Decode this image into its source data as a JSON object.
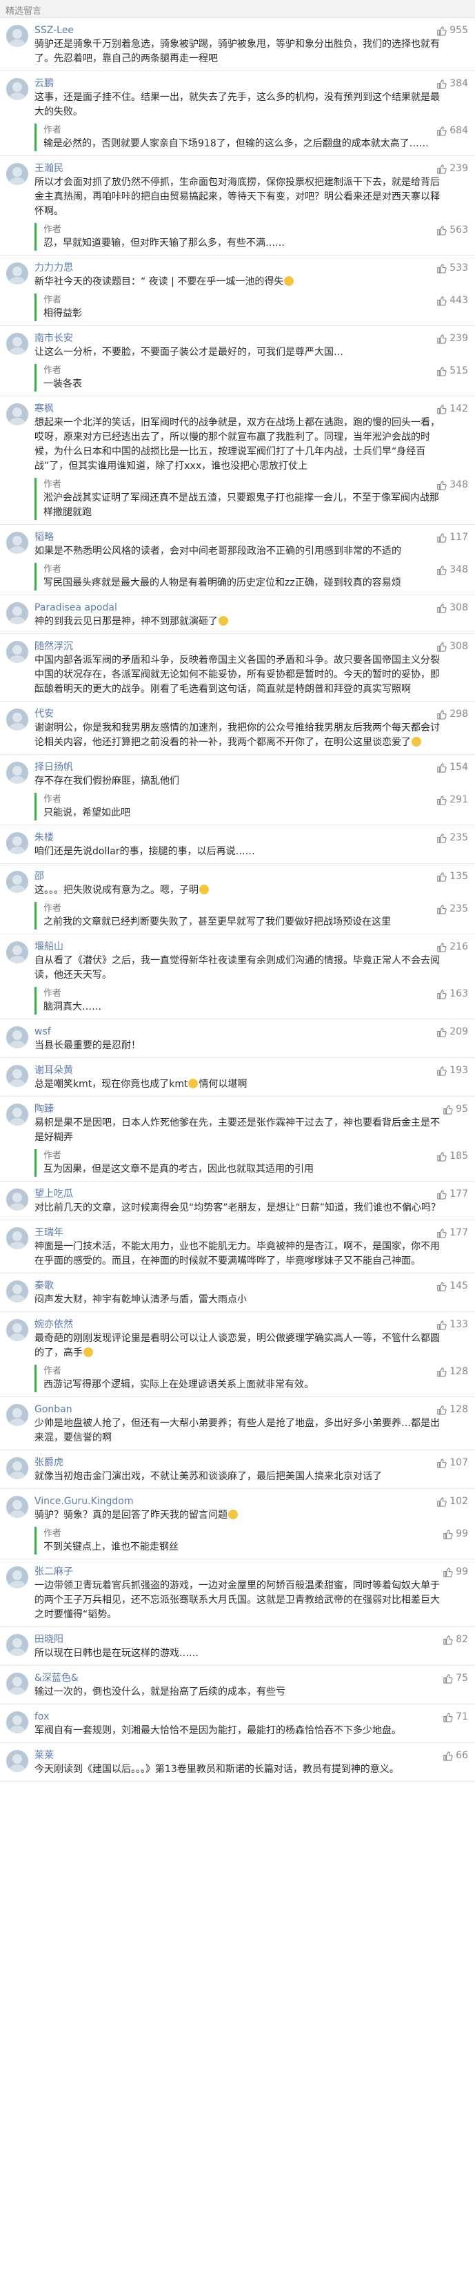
{
  "header": {
    "title": "精选留言"
  },
  "colors": {
    "name": "#5b7ba8",
    "author_bar": "#3cb043",
    "muted": "#8a8a8a"
  },
  "icons": {
    "like": "thumb-up-icon",
    "emoji": "emoji-icon"
  },
  "comments": [
    {
      "name": "SSZ-Lee",
      "likes": "955",
      "text": "骑驴还是骑象千万别着急选，骑象被驴踢，骑驴被象甩，等驴和象分出胜负，我们的选择也就有了。先忍着吧，靠自己的两条腿再走一程吧",
      "reply": null
    },
    {
      "name": "云鹏",
      "likes": "384",
      "text": "这事，还是面子挂不住。结果一出，就失去了先手，这么多的机构，没有预判到这个结果就是最大的失败。",
      "reply": {
        "name": "作者",
        "likes": "684",
        "text": "输是必然的，否则就要人家亲自下场918了，但输的这么多，之后翻盘的成本就太高了……"
      }
    },
    {
      "name": "王瀚民",
      "likes": "239",
      "text": "所以才会面对抓了放仍然不停抓，生命面包对海底捞，保你投票权把建制派干下去，就是给背后金主真热闹，再咱咔咔的把自由贸易搞起来，等待天下有变，对吧？明公看来还是对西天寨以释怀啊。",
      "reply": {
        "name": "作者",
        "likes": "563",
        "text": "忍，早就知道要输，但对昨天输了那么多，有些不满……"
      }
    },
    {
      "name": "力力力思",
      "likes": "533",
      "text": "新华社今天的夜读题目：“ 夜读 | 不要在乎一城一池的得失",
      "emoji": true,
      "reply": {
        "name": "作者",
        "likes": "443",
        "text": "相得益彰"
      }
    },
    {
      "name": "南市长安",
      "likes": "239",
      "text": "让这么一分析，不要脸，不要面子装公才是最好的，可我们是尊严大国…",
      "reply": {
        "name": "作者",
        "likes": "515",
        "text": "一装各表"
      }
    },
    {
      "name": "寒枫",
      "likes": "142",
      "text": "想起来一个北洋的笑话，旧军阀时代的战争就是，双方在战场上都在逃跑，跑的慢的回头一看，哎呀，原来对方已经逃出去了，所以慢的那个就宣布赢了我胜利了。同理，当年淞沪会战的时候，为什么日本和中国的战损比是一比五，按理说军阀们打了十几年内战，士兵们早“身经百战”了，但其实谁用谁知道，除了打xxx，谁也没把心思放打仗上",
      "reply": {
        "name": "作者",
        "likes": "348",
        "text": "淞沪会战其实证明了军阀还真不是战五渣，只要跟鬼子打也能撑一会儿，不至于像军阀内战那样撒腿就跑"
      }
    },
    {
      "name": "韬略",
      "likes": "117",
      "text": "如果是不熟悉明公风格的读者，会对中间老哥那段政治不正确的引用感到非常的不适的",
      "reply": {
        "name": "作者",
        "likes": "348",
        "text": "写民国最头疼就是最大最的人物是有着明确的历史定位和zz正确，碰到较真的容易烦"
      }
    },
    {
      "name": "Paradisea apodal",
      "likes": "308",
      "text": "神的到我云见日那是神，神不到那就演砸了",
      "emoji": true,
      "reply": null
    },
    {
      "name": "随然浮沉",
      "likes": "308",
      "text": "中国内部各派军阀的矛盾和斗争，反映着帝国主义各国的矛盾和斗争。故只要各国帝国主义分裂中国的状况存在，各派军阀就无论如何不能妥协，所有妥协都是暂时的。今天的暂时的妥协，即酝酿着明天的更大的战争。刚看了毛选看到这句话，简直就是特朗普和拜登的真实写照啊",
      "reply": null
    },
    {
      "name": "代安",
      "likes": "298",
      "text": "谢谢明公，你是我和我男朋友感情的加速剂，我把你的公众号推给我男朋友后我两个每天都会讨论相关内容，他还打算把之前没看的补一补，我两个都离不开你了，在明公这里谈恋爱了",
      "emoji": true,
      "reply": null
    },
    {
      "name": "择日扬帆",
      "likes": "154",
      "text": "存不存在我们假扮麻匪，搞乱他们",
      "reply": {
        "name": "作者",
        "likes": "291",
        "text": "只能说，希望如此吧"
      }
    },
    {
      "name": "朱楼",
      "likes": "235",
      "text": "咱们还是先说dollar的事，接腿的事，以后再说……",
      "reply": null
    },
    {
      "name": "邵",
      "likes": "135",
      "text": "这。。。把失败说成有意为之。嗯，子明",
      "emoji": true,
      "reply": {
        "name": "作者",
        "likes": "235",
        "text": "之前我的文章就已经判断要失败了，甚至更早就写了我们要做好把战场预设在这里"
      }
    },
    {
      "name": "堰船山",
      "likes": "216",
      "text": "自从看了《潜伏》之后，我一直觉得新华社夜读里有余则成们沟通的情报。毕竟正常人不会去阅读，他还天天写。",
      "reply": {
        "name": "作者",
        "likes": "163",
        "text": "脑洞真大……"
      }
    },
    {
      "name": "wsf",
      "likes": "209",
      "text": "当县长最重要的是忍耐！",
      "reply": null
    },
    {
      "name": "谢耳朵黄",
      "likes": "193",
      "text": "总是嘲笑kmt，现在你竟也成了kmt",
      "emoji": true,
      "tail": "情何以堪啊",
      "reply": null
    },
    {
      "name": "陶臻",
      "likes": "95",
      "text": "易帜是果不是因吧，日本人炸死他爹在先，主要还是张作霖神干过去了，神也要看背后金主是不是好糊弄",
      "reply": {
        "name": "作者",
        "likes": "185",
        "text": "互为因果，但是这文章不是真的考古，因此也就取其适用的引用"
      }
    },
    {
      "name": "望上吃瓜",
      "likes": "177",
      "text": "对比前几天的文章，这时候离得会见“均势客”老朋友，是想让“日薪”知道，我们谁也不偏心吗？",
      "reply": null
    },
    {
      "name": "王瑞年",
      "likes": "177",
      "text": "神面是一门技术活，不能太用力，业也不能肌无力。毕竟被神的是杏江，啊不，是国家，你不用在乎面的感受的。而且，在神面的时候就不要满嘴哗哗了，毕竟嗲嗲妹子又不能自己神面。",
      "reply": null
    },
    {
      "name": "秦歌",
      "likes": "145",
      "text": "闷声发大财，神宇有乾坤认清矛与盾，雷大雨点小",
      "reply": null
    },
    {
      "name": "婉亦依然",
      "likes": "133",
      "text": "最奇葩的刚刚发现评论里是看明公可以让人谈恋爱，明公做婆理学确实高人一等，不管什么都圆的了，高手",
      "emoji": true,
      "reply": {
        "name": "作者",
        "likes": "128",
        "text": "西游记写得那个逻辑，实际上在处理谚语关系上面就非常有效。"
      }
    },
    {
      "name": "Gonban",
      "likes": "128",
      "text": "少帅是地盘被人抢了，但还有一大帮小弟要养；有些人是抢了地盘，多出好多小弟要养…都是出来混，要信誉的啊",
      "reply": null
    },
    {
      "name": "张爵虎",
      "likes": "107",
      "text": "就像当初炮击金门演出戏，不就让美苏和谈谈麻了，最后把美国人搞来北京对话了",
      "reply": null
    },
    {
      "name": "Vince.Guru.Kingdom",
      "likes": "102",
      "text": "骑驴？骑象？真的是回答了昨天我的留言问题",
      "emoji": true,
      "reply": {
        "name": "作者",
        "likes": "99",
        "text": "不到关键点上，谁也不能走钢丝"
      }
    },
    {
      "name": "张二麻子",
      "likes": "99",
      "text": "一边带领卫青玩着官兵抓强盗的游戏，一边对金屋里的阿娇百般温柔甜蜜，同时等着匈奴大单于的两个王子万兵相见，还不忘派张骞联系大月氏国。这就是卫青教给武帝的在强弱对比相差巨大之时要懂得“韬势。",
      "reply": null
    },
    {
      "name": "田晓阳",
      "likes": "82",
      "text": "所以现在日韩也是在玩这样的游戏……",
      "reply": null
    },
    {
      "name": "&深蓝色&",
      "likes": "75",
      "text": "输过一次的，倒也没什么，就是抬高了后续的成本，有些亏",
      "reply": null
    },
    {
      "name": "fox",
      "likes": "71",
      "text": "军阀自有一套规则，刘湘最大恰恰不是因为能打，最能打的杨森恰恰吞不下多少地盘。",
      "reply": null
    },
    {
      "name": "莱莱",
      "likes": "66",
      "text": "今天刚读到《建国以后。。。》第13卷里教员和斯诺的长篇对话，教员有提到神的意义。",
      "reply": null
    }
  ]
}
